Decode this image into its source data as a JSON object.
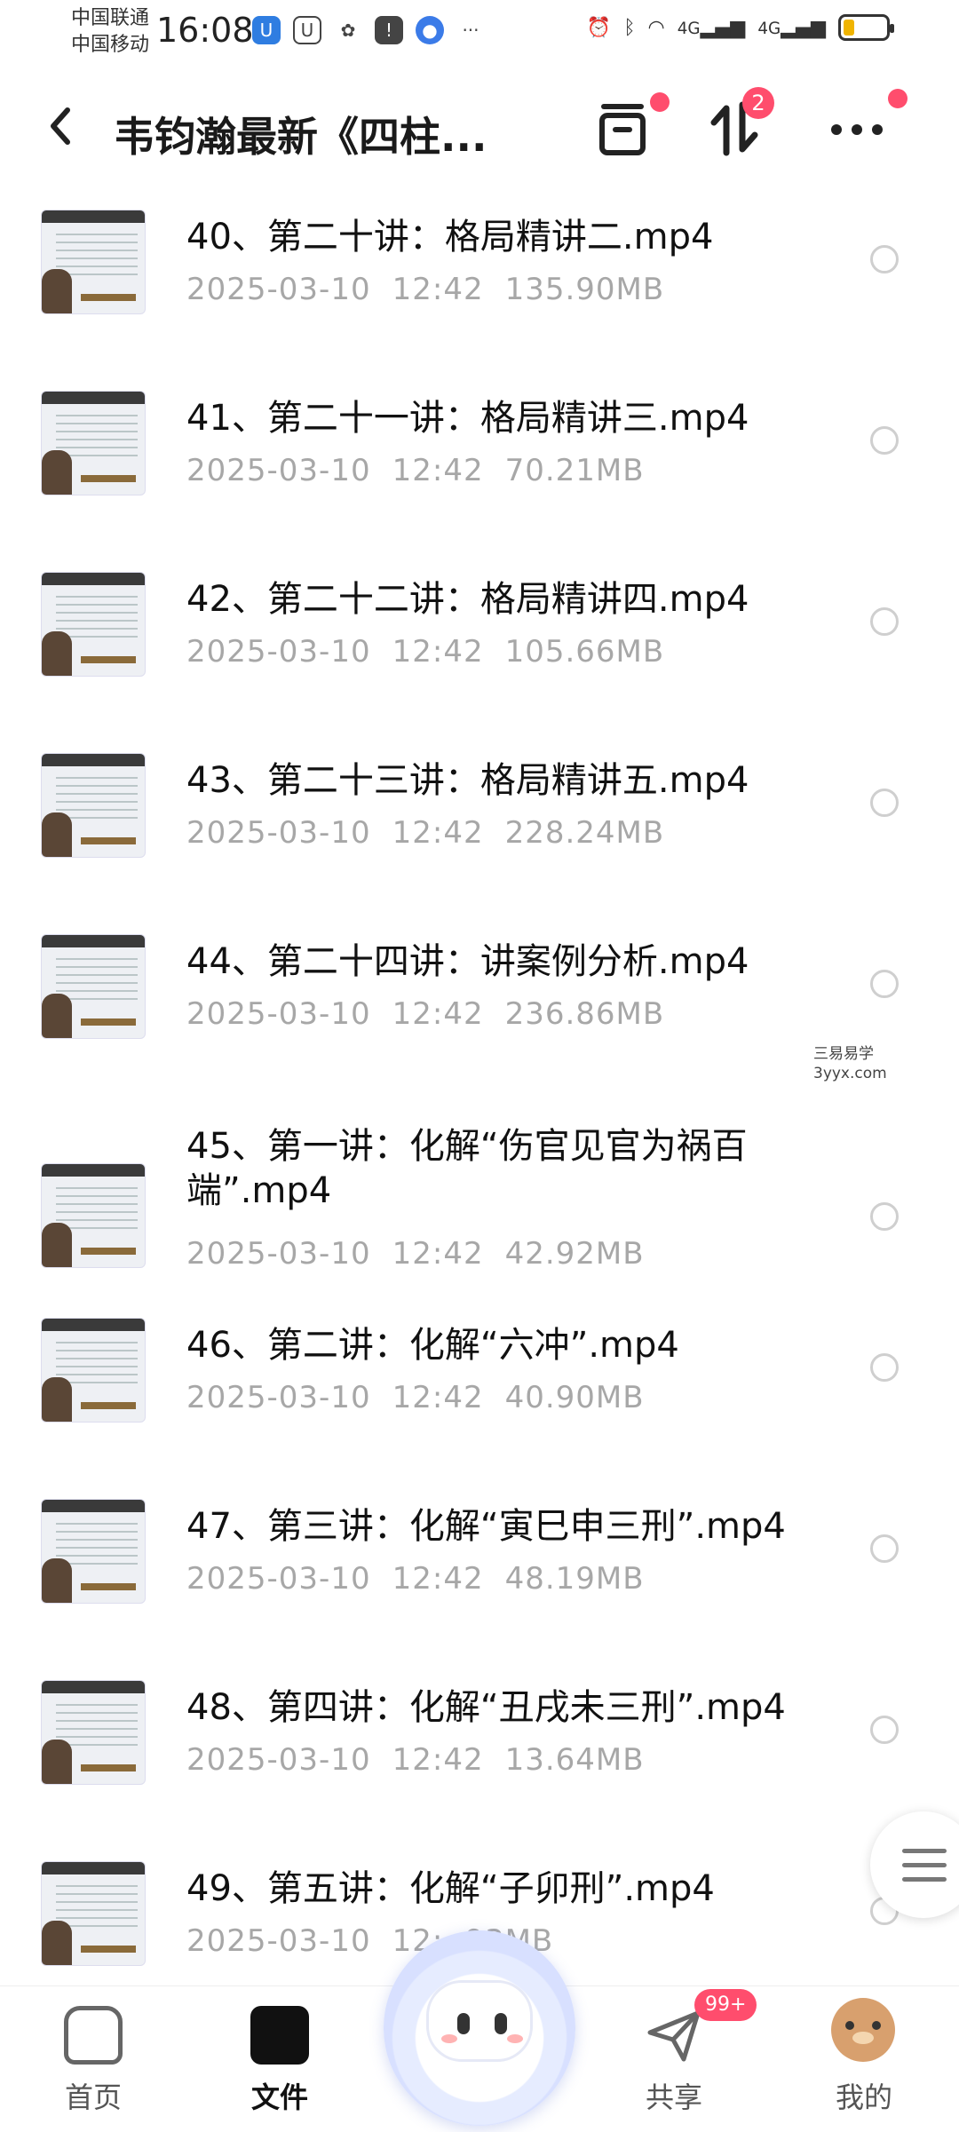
{
  "status_bar": {
    "carrier_1": "中国联通",
    "carrier_2": "中国移动",
    "time": "16:08",
    "network_1": "4G",
    "network_2": "4G",
    "battery_level": 0.25,
    "battery_color": "#f0b400"
  },
  "header": {
    "back_icon": "chevron-left-icon",
    "title": "韦钧瀚最新《四柱...",
    "archive_icon": "archive-icon",
    "sort_icon": "transfer-sort-icon",
    "sort_badge": "2",
    "more_icon": "more-horizontal-icon",
    "badge_color": "#ff4d6d"
  },
  "files": [
    {
      "name": "40、第二十讲：格局精讲二.mp4",
      "date": "2025-03-10",
      "time": "12:42",
      "size": "135.90MB"
    },
    {
      "name": "41、第二十一讲：格局精讲三.mp4",
      "date": "2025-03-10",
      "time": "12:42",
      "size": "70.21MB"
    },
    {
      "name": "42、第二十二讲：格局精讲四.mp4",
      "date": "2025-03-10",
      "time": "12:42",
      "size": "105.66MB"
    },
    {
      "name": "43、第二十三讲：格局精讲五.mp4",
      "date": "2025-03-10",
      "time": "12:42",
      "size": "228.24MB"
    },
    {
      "name": "44、第二十四讲：讲案例分析.mp4",
      "date": "2025-03-10",
      "time": "12:42",
      "size": "236.86MB"
    },
    {
      "name": "45、第一讲：化解“伤官见官为祸百端”.mp4",
      "date": "2025-03-10",
      "time": "12:42",
      "size": "42.92MB"
    },
    {
      "name": "46、第二讲：化解“六冲”.mp4",
      "date": "2025-03-10",
      "time": "12:42",
      "size": "40.90MB"
    },
    {
      "name": "47、第三讲：化解“寅巳申三刑”.mp4",
      "date": "2025-03-10",
      "time": "12:42",
      "size": "48.19MB"
    },
    {
      "name": "48、第四讲：化解“丑戌未三刑”.mp4",
      "date": "2025-03-10",
      "time": "12:42",
      "size": "13.64MB"
    },
    {
      "name": "49、第五讲：化解“子卯刑”.mp4",
      "date": "2025-03-10",
      "time": "12:",
      "size": "93MB"
    }
  ],
  "watermark": {
    "line1": "三易易学",
    "line2": "3yyx.com"
  },
  "bottom_nav": {
    "home": "首页",
    "files": "文件",
    "share": "共享",
    "share_badge": "99+",
    "mine": "我的"
  }
}
